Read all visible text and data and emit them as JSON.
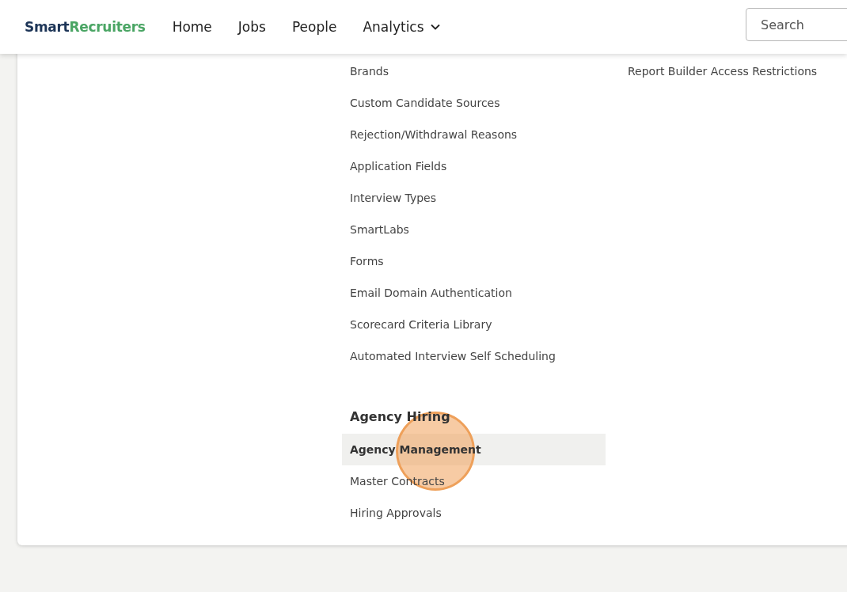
{
  "header": {
    "logo": {
      "first": "Smart",
      "second": "Recruiters"
    },
    "nav": [
      {
        "label": "Home",
        "dropdown": false
      },
      {
        "label": "Jobs",
        "dropdown": false
      },
      {
        "label": "People",
        "dropdown": false
      },
      {
        "label": "Analytics",
        "dropdown": true
      }
    ],
    "search": {
      "placeholder": "Search"
    }
  },
  "settings": {
    "columns": [
      {
        "sections": [
          {
            "items": [
              {
                "label": "Brands",
                "selected": false
              },
              {
                "label": "Custom Candidate Sources",
                "selected": false
              },
              {
                "label": "Rejection/Withdrawal Reasons",
                "selected": false
              },
              {
                "label": "Application Fields",
                "selected": false
              },
              {
                "label": "Interview Types",
                "selected": false
              },
              {
                "label": "SmartLabs",
                "selected": false
              },
              {
                "label": "Forms",
                "selected": false
              },
              {
                "label": "Email Domain Authentication",
                "selected": false
              },
              {
                "label": "Scorecard Criteria Library",
                "selected": false
              },
              {
                "label": "Automated Interview Self Scheduling",
                "selected": false
              }
            ]
          },
          {
            "title": "Agency Hiring",
            "items": [
              {
                "label": "Agency Management",
                "selected": true
              },
              {
                "label": "Master Contracts",
                "selected": false
              },
              {
                "label": "Hiring Approvals",
                "selected": false
              }
            ]
          }
        ]
      },
      {
        "sections": [
          {
            "items": [
              {
                "label": "Report Builder Access Restrictions",
                "selected": false
              }
            ]
          }
        ]
      }
    ]
  }
}
